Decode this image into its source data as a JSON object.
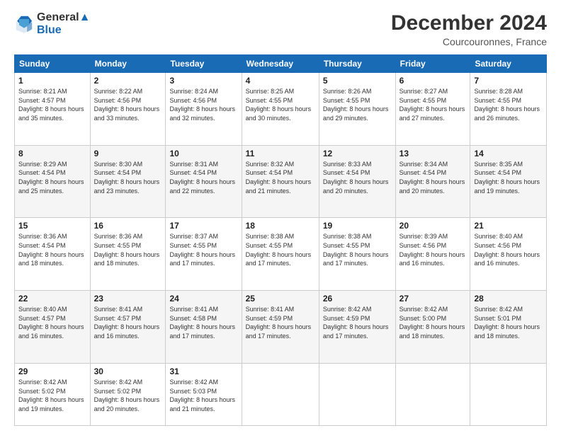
{
  "header": {
    "logo_line1": "General",
    "logo_line2": "Blue",
    "month": "December 2024",
    "location": "Courcouronnes, France"
  },
  "days_of_week": [
    "Sunday",
    "Monday",
    "Tuesday",
    "Wednesday",
    "Thursday",
    "Friday",
    "Saturday"
  ],
  "weeks": [
    [
      {
        "day": "1",
        "sunrise": "8:21 AM",
        "sunset": "4:57 PM",
        "daylight": "8 hours and 35 minutes."
      },
      {
        "day": "2",
        "sunrise": "8:22 AM",
        "sunset": "4:56 PM",
        "daylight": "8 hours and 33 minutes."
      },
      {
        "day": "3",
        "sunrise": "8:24 AM",
        "sunset": "4:56 PM",
        "daylight": "8 hours and 32 minutes."
      },
      {
        "day": "4",
        "sunrise": "8:25 AM",
        "sunset": "4:55 PM",
        "daylight": "8 hours and 30 minutes."
      },
      {
        "day": "5",
        "sunrise": "8:26 AM",
        "sunset": "4:55 PM",
        "daylight": "8 hours and 29 minutes."
      },
      {
        "day": "6",
        "sunrise": "8:27 AM",
        "sunset": "4:55 PM",
        "daylight": "8 hours and 27 minutes."
      },
      {
        "day": "7",
        "sunrise": "8:28 AM",
        "sunset": "4:55 PM",
        "daylight": "8 hours and 26 minutes."
      }
    ],
    [
      {
        "day": "8",
        "sunrise": "8:29 AM",
        "sunset": "4:54 PM",
        "daylight": "8 hours and 25 minutes."
      },
      {
        "day": "9",
        "sunrise": "8:30 AM",
        "sunset": "4:54 PM",
        "daylight": "8 hours and 23 minutes."
      },
      {
        "day": "10",
        "sunrise": "8:31 AM",
        "sunset": "4:54 PM",
        "daylight": "8 hours and 22 minutes."
      },
      {
        "day": "11",
        "sunrise": "8:32 AM",
        "sunset": "4:54 PM",
        "daylight": "8 hours and 21 minutes."
      },
      {
        "day": "12",
        "sunrise": "8:33 AM",
        "sunset": "4:54 PM",
        "daylight": "8 hours and 20 minutes."
      },
      {
        "day": "13",
        "sunrise": "8:34 AM",
        "sunset": "4:54 PM",
        "daylight": "8 hours and 20 minutes."
      },
      {
        "day": "14",
        "sunrise": "8:35 AM",
        "sunset": "4:54 PM",
        "daylight": "8 hours and 19 minutes."
      }
    ],
    [
      {
        "day": "15",
        "sunrise": "8:36 AM",
        "sunset": "4:54 PM",
        "daylight": "8 hours and 18 minutes."
      },
      {
        "day": "16",
        "sunrise": "8:36 AM",
        "sunset": "4:55 PM",
        "daylight": "8 hours and 18 minutes."
      },
      {
        "day": "17",
        "sunrise": "8:37 AM",
        "sunset": "4:55 PM",
        "daylight": "8 hours and 17 minutes."
      },
      {
        "day": "18",
        "sunrise": "8:38 AM",
        "sunset": "4:55 PM",
        "daylight": "8 hours and 17 minutes."
      },
      {
        "day": "19",
        "sunrise": "8:38 AM",
        "sunset": "4:55 PM",
        "daylight": "8 hours and 17 minutes."
      },
      {
        "day": "20",
        "sunrise": "8:39 AM",
        "sunset": "4:56 PM",
        "daylight": "8 hours and 16 minutes."
      },
      {
        "day": "21",
        "sunrise": "8:40 AM",
        "sunset": "4:56 PM",
        "daylight": "8 hours and 16 minutes."
      }
    ],
    [
      {
        "day": "22",
        "sunrise": "8:40 AM",
        "sunset": "4:57 PM",
        "daylight": "8 hours and 16 minutes."
      },
      {
        "day": "23",
        "sunrise": "8:41 AM",
        "sunset": "4:57 PM",
        "daylight": "8 hours and 16 minutes."
      },
      {
        "day": "24",
        "sunrise": "8:41 AM",
        "sunset": "4:58 PM",
        "daylight": "8 hours and 17 minutes."
      },
      {
        "day": "25",
        "sunrise": "8:41 AM",
        "sunset": "4:59 PM",
        "daylight": "8 hours and 17 minutes."
      },
      {
        "day": "26",
        "sunrise": "8:42 AM",
        "sunset": "4:59 PM",
        "daylight": "8 hours and 17 minutes."
      },
      {
        "day": "27",
        "sunrise": "8:42 AM",
        "sunset": "5:00 PM",
        "daylight": "8 hours and 18 minutes."
      },
      {
        "day": "28",
        "sunrise": "8:42 AM",
        "sunset": "5:01 PM",
        "daylight": "8 hours and 18 minutes."
      }
    ],
    [
      {
        "day": "29",
        "sunrise": "8:42 AM",
        "sunset": "5:02 PM",
        "daylight": "8 hours and 19 minutes."
      },
      {
        "day": "30",
        "sunrise": "8:42 AM",
        "sunset": "5:02 PM",
        "daylight": "8 hours and 20 minutes."
      },
      {
        "day": "31",
        "sunrise": "8:42 AM",
        "sunset": "5:03 PM",
        "daylight": "8 hours and 21 minutes."
      },
      null,
      null,
      null,
      null
    ]
  ]
}
